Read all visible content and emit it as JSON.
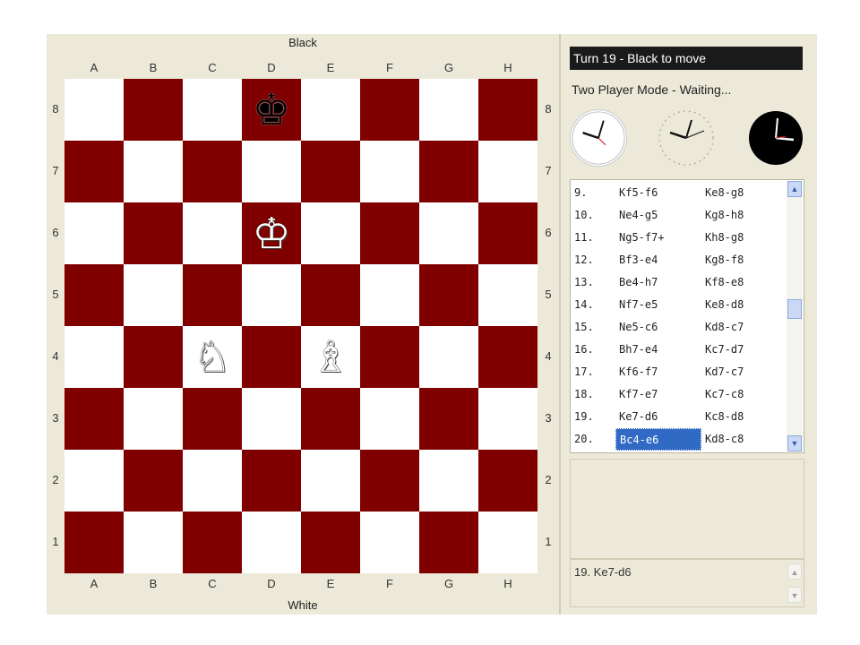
{
  "board": {
    "top_side_label": "Black",
    "bottom_side_label": "White",
    "files": [
      "A",
      "B",
      "C",
      "D",
      "E",
      "F",
      "G",
      "H"
    ],
    "ranks": [
      "8",
      "7",
      "6",
      "5",
      "4",
      "3",
      "2",
      "1"
    ],
    "light_color": "#ffffff",
    "dark_color": "#800000",
    "pieces": [
      {
        "square": "d8",
        "color": "black",
        "type": "king",
        "glyph": "♚"
      },
      {
        "square": "d6",
        "color": "white",
        "type": "king",
        "glyph": "♔"
      },
      {
        "square": "c4",
        "color": "white",
        "type": "knight",
        "glyph": "♘"
      },
      {
        "square": "e4",
        "color": "white",
        "type": "bishop",
        "glyph": "♗"
      }
    ]
  },
  "status": {
    "turn_text": "Turn 19 - Black to move",
    "mode_text": "Two Player Mode - Waiting..."
  },
  "clocks": [
    {
      "name": "white-clock",
      "face": "#ffffff",
      "hands": "#111111"
    },
    {
      "name": "center-clock",
      "face": "#ece9d8",
      "hands": "#111111"
    },
    {
      "name": "black-clock",
      "face": "#000000",
      "hands": "#ffffff"
    }
  ],
  "move_list": [
    {
      "num": "9.",
      "white": "Kf5-f6",
      "black": "Ke8-g8"
    },
    {
      "num": "10.",
      "white": "Ne4-g5",
      "black": "Kg8-h8"
    },
    {
      "num": "11.",
      "white": "Ng5-f7+",
      "black": "Kh8-g8"
    },
    {
      "num": "12.",
      "white": "Bf3-e4",
      "black": "Kg8-f8"
    },
    {
      "num": "13.",
      "white": "Be4-h7",
      "black": "Kf8-e8"
    },
    {
      "num": "14.",
      "white": "Nf7-e5",
      "black": "Ke8-d8"
    },
    {
      "num": "15.",
      "white": "Ne5-c6",
      "black": "Kd8-c7"
    },
    {
      "num": "16.",
      "white": "Bh7-e4",
      "black": "Kc7-d7"
    },
    {
      "num": "17.",
      "white": "Kf6-f7",
      "black": "Kd7-c7"
    },
    {
      "num": "18.",
      "white": "Kf7-e7",
      "black": "Kc7-c8"
    },
    {
      "num": "19.",
      "white": "Ke7-d6",
      "black": "Kc8-d8"
    },
    {
      "num": "20.",
      "white": "Bc4-e6",
      "black": "Kd8-c8",
      "selected_white": true
    }
  ],
  "notes": {
    "text": "19. Ke7-d6"
  },
  "scroll": {
    "up_glyph": "▲",
    "down_glyph": "▼"
  }
}
